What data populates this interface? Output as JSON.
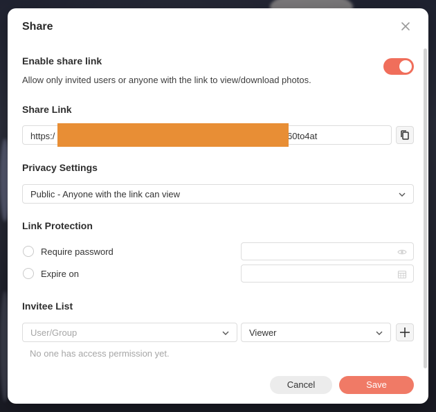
{
  "dialog": {
    "title": "Share"
  },
  "share_link_toggle": {
    "title": "Enable share link",
    "description": "Allow only invited users or anyone with the link to view/download photos.",
    "enabled": true
  },
  "share_link": {
    "title": "Share Link",
    "value_prefix": "https:/",
    "value_suffix": "60to4at"
  },
  "privacy": {
    "title": "Privacy Settings",
    "selected": "Public - Anyone with the link can view"
  },
  "protection": {
    "title": "Link Protection",
    "require_password_label": "Require password",
    "expire_on_label": "Expire on"
  },
  "invitees": {
    "title": "Invitee List",
    "user_placeholder": "User/Group",
    "role_selected": "Viewer",
    "empty_message": "No one has access permission yet."
  },
  "actions": {
    "cancel_label": "Cancel",
    "save_label": "Save"
  },
  "colors": {
    "accent": "#f06e5b",
    "redaction": "#e88e35"
  }
}
